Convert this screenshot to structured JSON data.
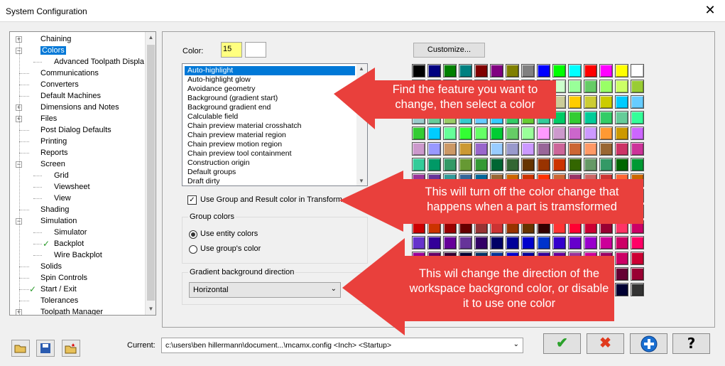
{
  "window": {
    "title": "System Configuration",
    "close_glyph": "✕"
  },
  "tree": {
    "items": [
      {
        "label": "Chaining",
        "expander": "+",
        "check": false
      },
      {
        "label": "Colors",
        "expander": "−",
        "check": false,
        "selected": true
      },
      {
        "label": "Advanced Toolpath Displa",
        "child": true
      },
      {
        "label": "Communications"
      },
      {
        "label": "Converters"
      },
      {
        "label": "Default Machines"
      },
      {
        "label": "Dimensions and Notes",
        "expander": "+"
      },
      {
        "label": "Files",
        "expander": "+"
      },
      {
        "label": "Post Dialog Defaults"
      },
      {
        "label": "Printing"
      },
      {
        "label": "Reports"
      },
      {
        "label": "Screen",
        "expander": "−"
      },
      {
        "label": "Grid",
        "child": true
      },
      {
        "label": "Viewsheet",
        "child": true
      },
      {
        "label": "View",
        "child": true
      },
      {
        "label": "Shading"
      },
      {
        "label": "Simulation",
        "expander": "−"
      },
      {
        "label": "Simulator",
        "child": true
      },
      {
        "label": "Backplot",
        "child": true,
        "check": true
      },
      {
        "label": "Wire Backplot",
        "child": true
      },
      {
        "label": "Solids"
      },
      {
        "label": "Spin Controls"
      },
      {
        "label": "Start / Exit",
        "check": true
      },
      {
        "label": "Tolerances"
      },
      {
        "label": "Toolpath Manager",
        "expander": "+"
      }
    ]
  },
  "color": {
    "label": "Color:",
    "value": "15",
    "swatch": "#ffffff"
  },
  "customize_label": "Customize...",
  "features": [
    "Auto-highlight",
    "Auto-highlight glow",
    "Avoidance geometry",
    "Background (gradient start)",
    "Background gradient end",
    "Calculable field",
    "Chain preview material crosshatch",
    "Chain preview material region",
    "Chain preview motion region",
    "Chain preview tool containment",
    "Construction origin",
    "Default groups",
    "Draft dirty"
  ],
  "use_group_checkbox": {
    "label": "Use Group and Result color in Transform",
    "checked": true
  },
  "group_colors": {
    "legend": "Group colors",
    "option1": "Use entity colors",
    "option2": "Use group's color",
    "selected": 1
  },
  "gradient": {
    "legend": "Gradient background direction",
    "value": "Horizontal"
  },
  "callouts": {
    "c1": "Find the feature you want to change, then select a color",
    "c2": "This will turn off the color change that happens when a part is tramsformed",
    "c3": "This wil change the direction of the workspace backgrond color, or disable it to use one color"
  },
  "palette": {
    "rows": [
      [
        "#000000",
        "#000080",
        "#008000",
        "#008080",
        "#800000",
        "#800080",
        "#808000",
        "#808080",
        "#0000ff",
        "#00ff00",
        "#00ffff",
        "#ff0000",
        "#ff00ff",
        "#ffff00",
        "#ffffff"
      ],
      [
        "#ccff00",
        "#99ff33",
        "#66ff66",
        "#33ffcc",
        "#00ff99",
        "#33cc33",
        "#00ff66",
        "#66ffcc",
        "#00ffcc",
        "#ccffcc",
        "#99ff99",
        "#66cc66",
        "#99ff66",
        "#ccff66",
        "#99cc33"
      ],
      [
        "#ffff66",
        "#cccc00",
        "#cccc66",
        "#33ffff",
        "#66ffff",
        "#99ffff",
        "#00cccc",
        "#66cccc",
        "#cccccc",
        "#cccc99",
        "#ffcc00",
        "#cccc33",
        "#cccc00",
        "#00ccff",
        "#66ccff"
      ],
      [
        "#99cccc",
        "#66cc99",
        "#99cc66",
        "#33cccc",
        "#66ccff",
        "#33ccff",
        "#33cc66",
        "#66cc33",
        "#33cc99",
        "#00cc66",
        "#33cc33",
        "#00cc99",
        "#33cc66",
        "#66cc99",
        "#33ff99"
      ],
      [
        "#33cc33",
        "#00ccff",
        "#66ff99",
        "#33ff33",
        "#66ff66",
        "#00cc33",
        "#66cc66",
        "#99ff99",
        "#ff99ff",
        "#cc99cc",
        "#cc66cc",
        "#cc99ff",
        "#ff9933",
        "#cc9900",
        "#cc66ff"
      ],
      [
        "#cc99cc",
        "#9999ff",
        "#cc9966",
        "#cc9933",
        "#9966cc",
        "#99ccff",
        "#9999cc",
        "#cc99ff",
        "#996699",
        "#cc6699",
        "#cc6633",
        "#ff9966",
        "#996633",
        "#cc3366",
        "#cc3399"
      ],
      [
        "#33cc99",
        "#009966",
        "#339966",
        "#669933",
        "#339933",
        "#006633",
        "#336633",
        "#663300",
        "#993300",
        "#cc3300",
        "#336600",
        "#669966",
        "#339966",
        "#006600",
        "#009933"
      ],
      [
        "#993399",
        "#663399",
        "#339999",
        "#336699",
        "#006699",
        "#996633",
        "#cc6600",
        "#cc3300",
        "#ff3300",
        "#cc6633",
        "#993366",
        "#cc6666",
        "#cc3333",
        "#ff6633",
        "#cc6600"
      ],
      [
        "#009999",
        "#3399cc",
        "#006699",
        "#3366cc",
        "#336699",
        "#669999",
        "#996699",
        "#6666cc",
        "#9999cc",
        "#99cc99",
        "#669966",
        "#339999",
        "#006666",
        "#009999",
        "#0099cc"
      ],
      [
        "#3333ff",
        "#3366ff",
        "#6666ff",
        "#339966",
        "#336633",
        "#006633",
        "#3366cc",
        "#0066ff",
        "#9933ff",
        "#cc33cc",
        "#993399",
        "#660066",
        "#663366",
        "#993366",
        "#cc00cc"
      ],
      [
        "#cc0000",
        "#cc3300",
        "#990000",
        "#660000",
        "#993333",
        "#cc3333",
        "#993300",
        "#663300",
        "#330000",
        "#ff3333",
        "#ff0033",
        "#cc0033",
        "#990033",
        "#ff3366",
        "#cc0066"
      ],
      [
        "#6633cc",
        "#330099",
        "#660099",
        "#663399",
        "#330066",
        "#000066",
        "#000099",
        "#0000cc",
        "#0033cc",
        "#3300cc",
        "#6600cc",
        "#9900cc",
        "#cc0099",
        "#cc0066",
        "#ff0066"
      ],
      [
        "#990099",
        "#660066",
        "#330033",
        "#000033",
        "#003366",
        "#003399",
        "#0000cc",
        "#000099",
        "#330099",
        "#660099",
        "#993399",
        "#cc0099",
        "#990066",
        "#cc0066",
        "#cc0033"
      ],
      [
        "#660066",
        "#993366",
        "#660033",
        "#330033",
        "#000033",
        "#003333",
        "#006666",
        "#003366",
        "#000066",
        "#330066",
        "#663366",
        "#660066",
        "#330033",
        "#660033",
        "#990033"
      ],
      [
        "#000066",
        "#000033",
        "#330033",
        "#000000",
        "#003333",
        "#000033",
        "#330066",
        "#000066",
        "#003366",
        "#000033",
        "#333366",
        "#000099",
        "#000066",
        "#000033",
        "#333333"
      ]
    ]
  },
  "current": {
    "label": "Current:",
    "value": "c:\\users\\ben hillermann\\document...\\mcamx.config <Inch> <Startup>"
  },
  "buttons": {
    "ok": "✔",
    "cancel": "✖",
    "add": "+",
    "help": "?"
  },
  "icons": {
    "open": "folder-open-icon",
    "save": "save-icon",
    "merge": "folder-merge-icon"
  },
  "accent": "#0078d7",
  "callout_color": "#e9403c"
}
